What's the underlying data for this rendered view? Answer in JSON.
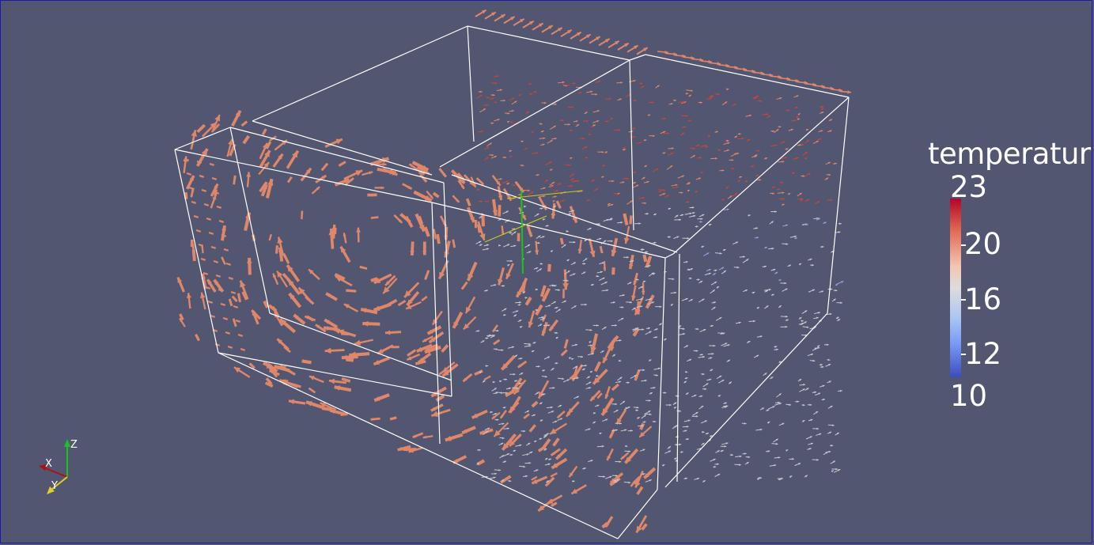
{
  "legend": {
    "title": "temperatur",
    "max_label": "23",
    "labels": [
      "20",
      "16",
      "12"
    ],
    "min_label": "10"
  },
  "orientation_axes": {
    "x_label": "X",
    "y_label": "Y",
    "z_label": "Z"
  },
  "colors": {
    "background": "#525670",
    "box_outline": "#ffffff",
    "arrow_warm": "#e0876a",
    "arrow_red": "#c9473a",
    "arrow_cool": "#8ea7e0",
    "x_axis": "#b01010",
    "y_axis": "#e0d020",
    "z_axis": "#20c020"
  }
}
